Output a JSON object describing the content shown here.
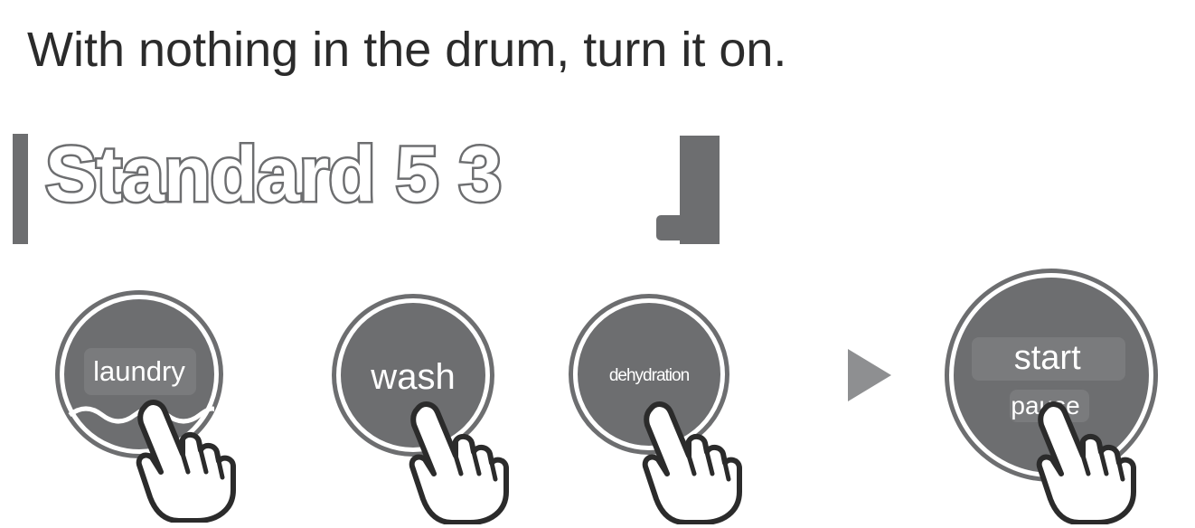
{
  "instruction": "With nothing in the drum, turn it on.",
  "display": {
    "text": "Standard 5 3"
  },
  "buttons": {
    "laundry": "laundry",
    "wash": "wash",
    "dehydration": "dehydration",
    "start": "start",
    "pause": "pause"
  },
  "icons": [
    "pointing-hand-icon",
    "play-arrow-icon",
    "water-wave-icon"
  ],
  "colors": {
    "panel_gray": "#6d6e70",
    "arrow_gray": "#8e8f91"
  }
}
